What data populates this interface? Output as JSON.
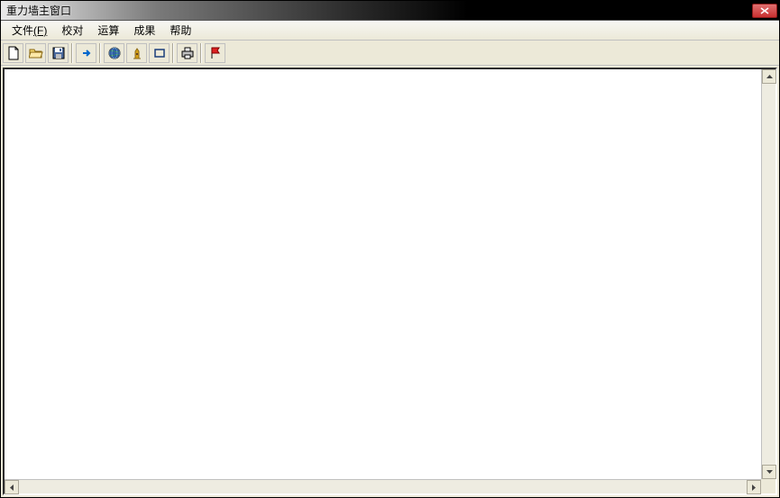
{
  "window": {
    "title": "重力墙主窗口"
  },
  "menu": {
    "file": "文件",
    "file_accel": "(F)",
    "check": "校对",
    "calc": "运算",
    "result": "成果",
    "help": "帮助"
  },
  "toolbar": {
    "new": "new-file-icon",
    "open": "open-folder-icon",
    "save": "save-disk-icon",
    "arrow": "arrow-right-icon",
    "globe": "globe-icon",
    "tower": "tower-icon",
    "rect": "rectangle-icon",
    "print": "printer-icon",
    "flag": "flag-icon"
  }
}
